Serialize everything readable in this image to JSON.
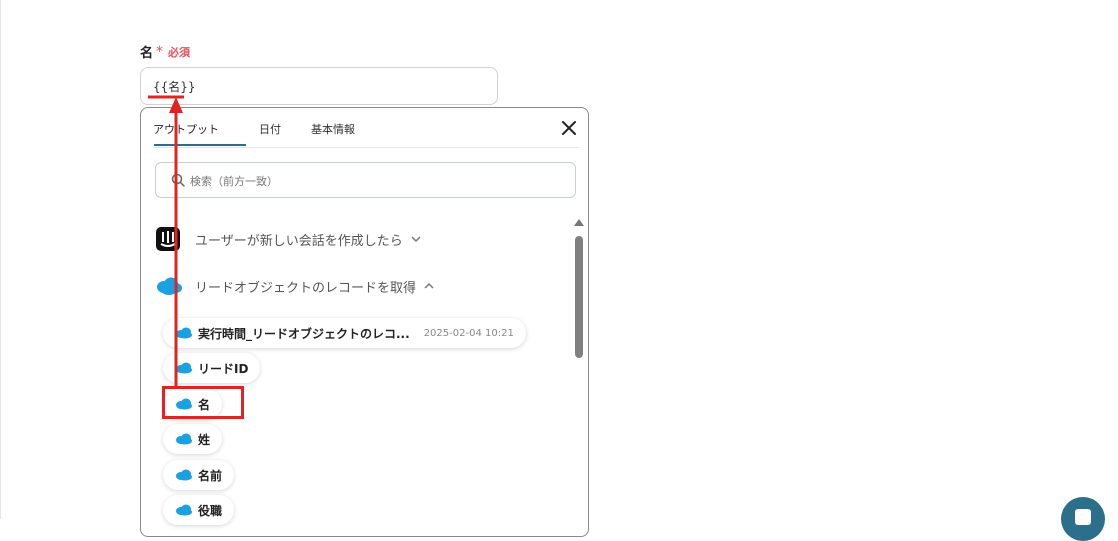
{
  "field": {
    "label": "名",
    "required_star": "*",
    "required_text": "必須",
    "value": "{{名}}"
  },
  "dropdown": {
    "tabs": [
      {
        "label": "アウトプット",
        "active": true
      },
      {
        "label": "日付",
        "active": false
      },
      {
        "label": "基本情報",
        "active": false
      }
    ],
    "close_icon": "close-icon",
    "search_placeholder": "検索（前方一致）",
    "groups": [
      {
        "label": "ユーザーが新しい会話を作成したら",
        "icon": "intercom-icon",
        "expanded": false
      },
      {
        "label": "リードオブジェクトのレコードを取得",
        "icon": "salesforce-cloud-icon",
        "expanded": true
      }
    ],
    "items": [
      {
        "label": "実行時間_リードオブジェクトのレコ...",
        "meta": "2025-02-04 10:21"
      },
      {
        "label": "リードID"
      },
      {
        "label": "名"
      },
      {
        "label": "姓"
      },
      {
        "label": "名前"
      },
      {
        "label": "役職"
      }
    ]
  },
  "colors": {
    "required": "#e8505b",
    "tab_accent": "#2b6f8a",
    "annotation": "#e02424",
    "salesforce": "#1ba1e0"
  }
}
